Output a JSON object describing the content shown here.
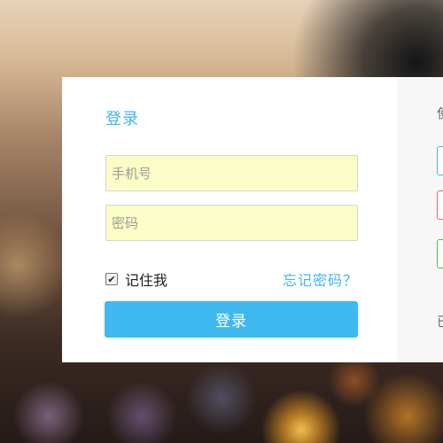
{
  "login": {
    "title": "登录",
    "phone_placeholder": "手机号",
    "password_placeholder": "密码",
    "remember_label": "记住我",
    "remember_checked": true,
    "forgot_label": "忘记密码？",
    "submit_label": "登录"
  },
  "side_panel": {
    "heading_fragment": "使",
    "footer_fragment": "已"
  },
  "colors": {
    "accent": "#41b6ee",
    "button": "#3fb8f0",
    "input_bg": "#fbfdc6"
  }
}
